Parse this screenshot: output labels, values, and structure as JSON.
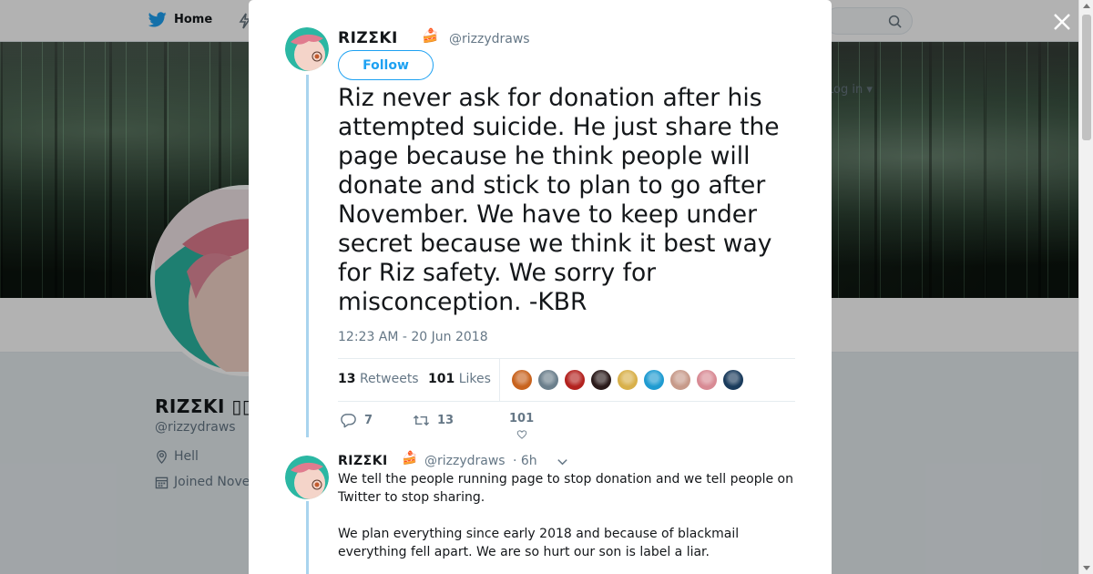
{
  "background_page": {
    "nav": {
      "home_label": "Home",
      "login_label": "Log in"
    },
    "profile": {
      "name": "RIZΣKI ▯▯",
      "handle": "@rizzydraws",
      "location": "Hell",
      "joined": "Joined Nove"
    },
    "colors": {
      "brand_blue": "#1da1f2"
    }
  },
  "modal": {
    "close_icon": "close-icon",
    "tweet": {
      "author_name": "RIZΣKI",
      "cake": "🍰",
      "handle": "@rizzydraws",
      "follow_label": "Follow",
      "text": "Riz never ask for donation after his attempted suicide. He just share the page because he think people will donate and stick to plan to go after November. We have to keep under secret because we think it best way for Riz safety. We sorry for misconception. -KBR",
      "timestamp": "12:23 AM - 20 Jun 2018",
      "retweets_count": "13",
      "retweets_label": "Retweets",
      "likes_count": "101",
      "likes_label": "Likes",
      "liker_colors": [
        "#c8631e",
        "#6b7f8c",
        "#b3221f",
        "#2a1a1a",
        "#d8b04a",
        "#1f9bd1",
        "#c79a8a",
        "#d88a94",
        "#1a3b5c"
      ],
      "reply_count": "7",
      "retweet_action_count": "13",
      "like_action_count": "101"
    },
    "reply": {
      "author_name": "RIZΣKI",
      "cake": "🍰",
      "handle": "@rizzydraws",
      "time": "· 6h",
      "paragraphs": [
        "We tell the people running page to stop donation and we tell people on Twitter to stop sharing.",
        "We plan everything since early 2018 and because of blackmail everything fell apart. We are so hurt our son is label a liar."
      ]
    }
  }
}
